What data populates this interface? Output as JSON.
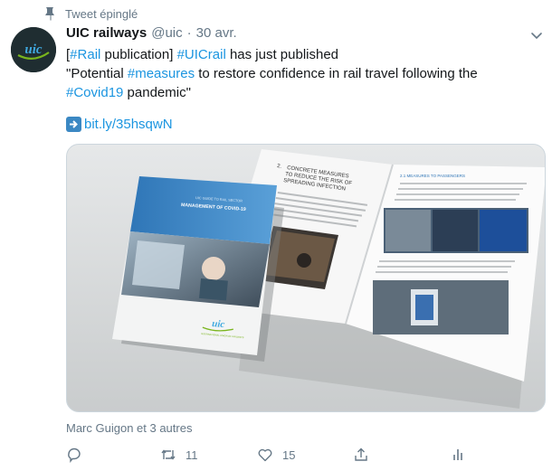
{
  "pinned": {
    "label": "Tweet épinglé",
    "icon": "pin-icon"
  },
  "author": {
    "display_name": "UIC railways",
    "handle": "@uic",
    "separator": "·",
    "date": "30 avr.",
    "avatar_text": "uic"
  },
  "tweet": {
    "line1": {
      "open_bracket": "[",
      "tag1": "#Rail",
      "text1": " publication] ",
      "tag2": "#UICrail",
      "text2": " has just published"
    },
    "line2": {
      "text1": "\"Potential ",
      "tag1": "#measures",
      "text2": " to restore confidence in rail travel following the"
    },
    "line3": {
      "tag1": "#Covid19",
      "text1": " pandemic\""
    },
    "link": "bit.ly/35hsqwN"
  },
  "media": {
    "cover_kicker": "UIC GUIDE TO RAIL SECTOR",
    "cover_title": "MANAGEMENT OF COVID-19",
    "cover_logo": "uic",
    "cover_logo_caption": "INTERNATIONAL UNION OF RAILWAYS",
    "page_heading_num": "2.",
    "page_heading_line1": "CONCRETE MEASURES",
    "page_heading_line2": "TO REDUCE THE RISK OF",
    "page_heading_line3": "SPREADING INFECTION",
    "right_heading": "2.1  MEASURES TO PASSENGERS"
  },
  "liked_by": "Marc Guigon et 3 autres",
  "actions": {
    "reply_count": "",
    "retweet_count": "11",
    "like_count": "15"
  },
  "colors": {
    "link": "#1b95e0",
    "muted": "#657786",
    "uic_green": "#7ab51d"
  }
}
